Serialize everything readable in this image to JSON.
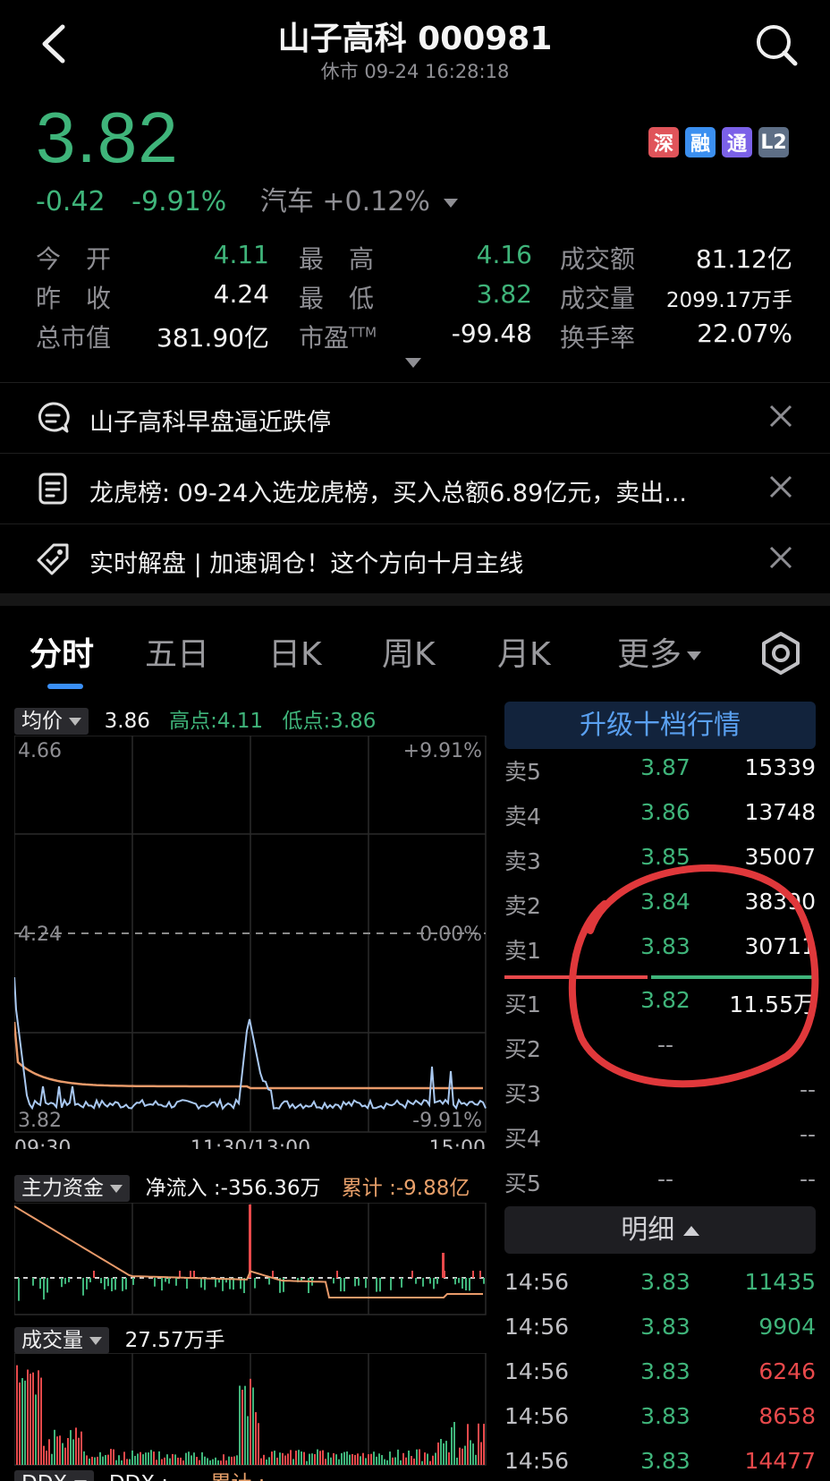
{
  "header": {
    "title": "山子高科 000981",
    "status": "休市 09-24 16:28:18"
  },
  "quote": {
    "price": "3.82",
    "change": "-0.42",
    "change_pct": "-9.91%",
    "sector": "汽车 +0.12%",
    "badges": [
      {
        "text": "深",
        "color": "#e0545a"
      },
      {
        "text": "融",
        "color": "#3b8ff0"
      },
      {
        "text": "通",
        "color": "#7b61e8"
      },
      {
        "text": "L2",
        "color": "#5e6f86"
      }
    ]
  },
  "stats": {
    "open_label": "今　开",
    "open": "4.11",
    "high_label": "最　高",
    "high": "4.16",
    "amount_label": "成交额",
    "amount": "81.12亿",
    "prev_label": "昨　收",
    "prev": "4.24",
    "low_label": "最　低",
    "low": "3.82",
    "volume_label": "成交量",
    "volume": "2099.17万手",
    "mcap_label": "总市值",
    "mcap": "381.90亿",
    "pe_label": "市盈",
    "pe_sup": "TTM",
    "pe": "-99.48",
    "turnover_label": "换手率",
    "turnover": "22.07%"
  },
  "news": [
    {
      "icon": "chat-icon",
      "text": "山子高科早盘逼近跌停"
    },
    {
      "icon": "document-icon",
      "text": "龙虎榜: 09-24入选龙虎榜，买入总额6.89亿元，卖出..."
    },
    {
      "icon": "tag-icon",
      "text": "实时解盘 | 加速调仓！这个方向十月主线"
    }
  ],
  "tabs": [
    "分时",
    "五日",
    "日K",
    "周K",
    "月K",
    "更多"
  ],
  "chart_head": {
    "avg_chip": "均价",
    "avg_value": "3.86",
    "high_point": "高点:4.11",
    "low_point": "低点:3.86",
    "y_top": "4.66",
    "y_top_pct": "+9.91%",
    "y_mid": "4.24",
    "y_mid_pct": "0.00%",
    "y_bot": "3.82",
    "y_bot_pct": "-9.91%",
    "x_start": "09:30",
    "x_mid": "11:30/13:00",
    "x_end": "15:00"
  },
  "fund_head": {
    "chip": "主力资金",
    "net": "净流入 :-356.36万",
    "cum": "累计 :-9.88亿"
  },
  "vol_head": {
    "chip": "成交量",
    "value": "27.57万手"
  },
  "bottom_head": {
    "chip": "DDX",
    "ddx": "DDX :",
    "cum": "累计 :"
  },
  "orderbook": {
    "upgrade": "升级十档行情",
    "asks": [
      {
        "label": "卖5",
        "price": "3.87",
        "vol": "15339"
      },
      {
        "label": "卖4",
        "price": "3.86",
        "vol": "13748"
      },
      {
        "label": "卖3",
        "price": "3.85",
        "vol": "35007"
      },
      {
        "label": "卖2",
        "price": "3.84",
        "vol": "38390"
      },
      {
        "label": "卖1",
        "price": "3.83",
        "vol": "30711"
      }
    ],
    "bids": [
      {
        "label": "买1",
        "price": "3.82",
        "vol": "11.55万"
      },
      {
        "label": "买2",
        "price": "--",
        "vol": ""
      },
      {
        "label": "买3",
        "price": "",
        "vol": "--"
      },
      {
        "label": "买4",
        "price": "",
        "vol": "--"
      },
      {
        "label": "买5",
        "price": "--",
        "vol": "--"
      }
    ]
  },
  "detail": {
    "button": "明细",
    "rows": [
      {
        "time": "14:56",
        "price": "3.83",
        "vol": "11435",
        "color": "#3fb47a"
      },
      {
        "time": "14:56",
        "price": "3.83",
        "vol": "9904",
        "color": "#3fb47a"
      },
      {
        "time": "14:56",
        "price": "3.83",
        "vol": "6246",
        "color": "#e8494b"
      },
      {
        "time": "14:56",
        "price": "3.83",
        "vol": "8658",
        "color": "#e8494b"
      },
      {
        "time": "14:56",
        "price": "3.83",
        "vol": "14477",
        "color": "#e8494b"
      }
    ]
  }
}
